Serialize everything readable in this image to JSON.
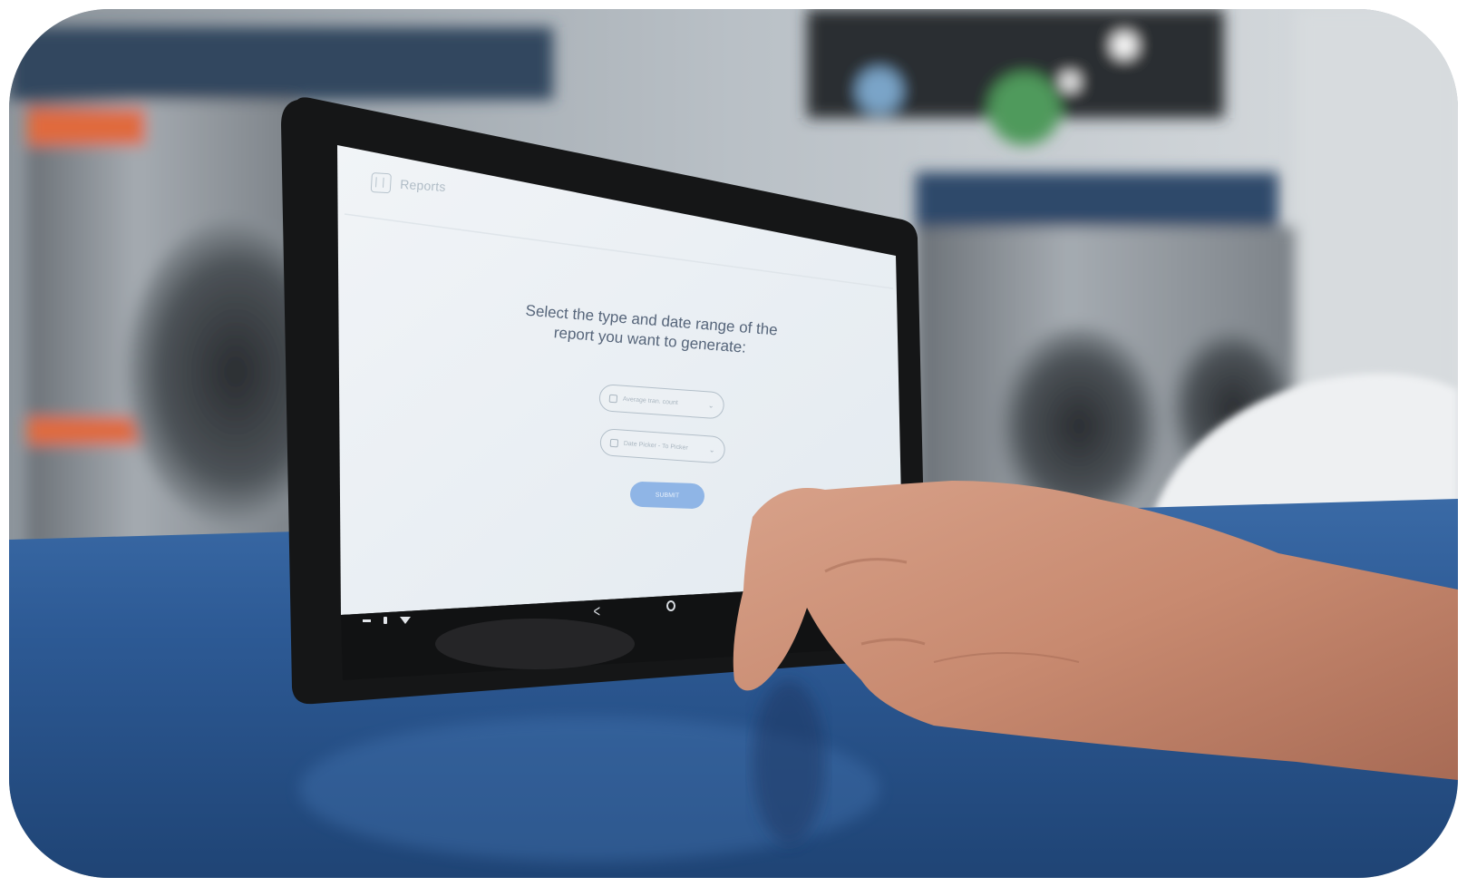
{
  "app": {
    "title": "Reports"
  },
  "prompt": {
    "line1": "Select the type and date range of the",
    "line2": "report you want to generate:"
  },
  "form": {
    "report_type_text": "Average tran. count",
    "date_range_text": "Date Picker - To Picker",
    "submit_label": "SUBMIT"
  },
  "nav": {
    "back_icon": "chevron-left-icon",
    "home_icon": "circle-home-icon"
  },
  "colors": {
    "counter_blue": "#2c5a93",
    "submit_button": "#8fb5e6",
    "screen_bg": "#e9eef3",
    "prompt_text": "#56657a"
  }
}
